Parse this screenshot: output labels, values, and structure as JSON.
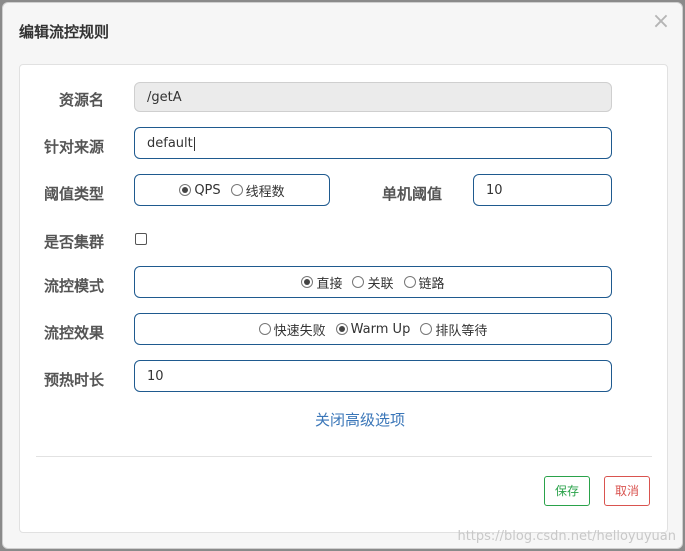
{
  "dialog": {
    "title": "编辑流控规则",
    "close_glyph": "×"
  },
  "form": {
    "resource_name": {
      "label": "资源名",
      "value": "/getA"
    },
    "source": {
      "label": "针对来源",
      "value": "default"
    },
    "threshold_type": {
      "label": "阈值类型",
      "options": [
        {
          "label": "QPS",
          "selected": true
        },
        {
          "label": "线程数",
          "selected": false
        }
      ]
    },
    "single_threshold": {
      "label": "单机阈值",
      "value": "10"
    },
    "cluster": {
      "label": "是否集群",
      "checked": false
    },
    "control_mode": {
      "label": "流控模式",
      "options": [
        {
          "label": "直接",
          "selected": true
        },
        {
          "label": "关联",
          "selected": false
        },
        {
          "label": "链路",
          "selected": false
        }
      ]
    },
    "control_effect": {
      "label": "流控效果",
      "options": [
        {
          "label": "快速失败",
          "selected": false
        },
        {
          "label": "Warm Up",
          "selected": true
        },
        {
          "label": "排队等待",
          "selected": false
        }
      ]
    },
    "warmup_duration": {
      "label": "预热时长",
      "value": "10"
    },
    "advanced_toggle": "关闭高级选项"
  },
  "footer": {
    "save_label": "保存",
    "cancel_label": "取消"
  },
  "watermark": "https://blog.csdn.net/helloyuyuan",
  "colors": {
    "accent": "#1f5a8f",
    "link": "#3a76b8",
    "save": "#2aa24a",
    "cancel": "#d9534f"
  },
  "icons": {
    "close": "close-icon"
  }
}
